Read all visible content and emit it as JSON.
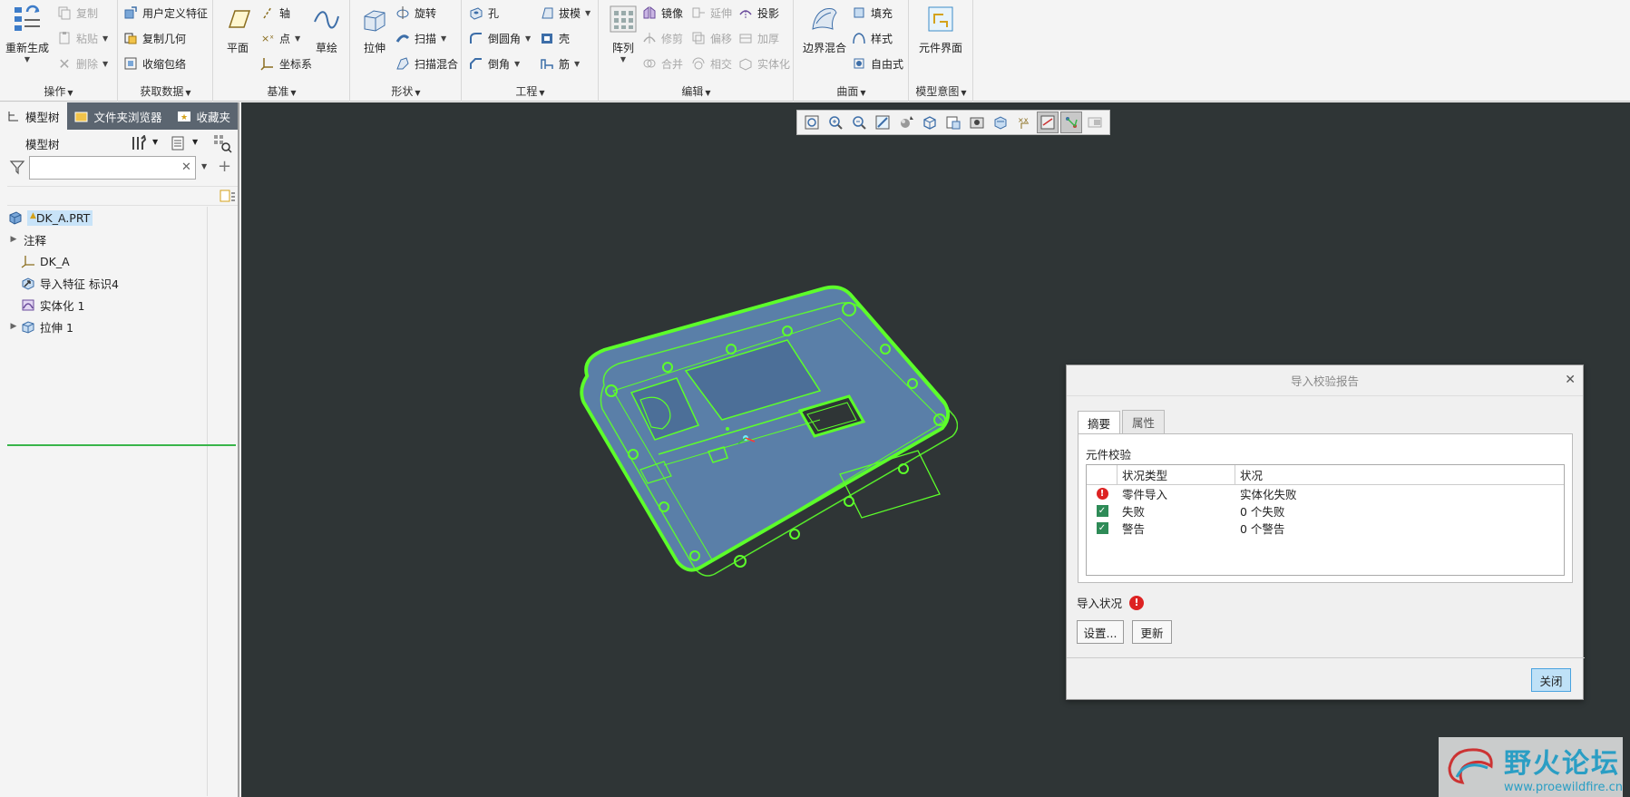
{
  "ribbon": {
    "operations": {
      "label": "操作",
      "regenerate": "重新生成",
      "copy": "复制",
      "paste": "粘贴",
      "delete": "删除"
    },
    "get_data": {
      "label": "获取数据",
      "udf": "用户定义特征",
      "copy_geometry": "复制几何",
      "shrinkwrap": "收缩包络"
    },
    "datum": {
      "label": "基准",
      "plane": "平面",
      "axis": "轴",
      "point": "点",
      "csys": "坐标系",
      "sketch": "草绘"
    },
    "shapes": {
      "label": "形状",
      "extrude": "拉伸",
      "revolve": "旋转",
      "sweep": "扫描",
      "swept_blend": "扫描混合"
    },
    "engineering": {
      "label": "工程",
      "hole": "孔",
      "round": "倒圆角",
      "chamfer": "倒角",
      "draft": "拔模",
      "shell": "壳",
      "rib": "筋"
    },
    "editing": {
      "label": "编辑",
      "pattern": "阵列",
      "mirror": "镜像",
      "trim": "修剪",
      "merge": "合并",
      "extend": "延伸",
      "offset": "偏移",
      "intersect": "相交",
      "project": "投影",
      "thicken": "加厚",
      "solidify": "实体化"
    },
    "surfaces": {
      "label": "曲面",
      "boundary_blend": "边界混合",
      "fill": "填充",
      "style": "样式",
      "freestyle": "自由式"
    },
    "model_intent": {
      "label": "模型意图",
      "component_interface": "元件界面"
    }
  },
  "left_panel": {
    "tabs": [
      "模型树",
      "文件夹浏览器",
      "收藏夹"
    ],
    "tree_title": "模型树",
    "filter_placeholder": "",
    "items": [
      {
        "label": "DK_A.PRT",
        "icon": "part-icon",
        "expandable": false
      },
      {
        "label": "注释",
        "icon": "",
        "expandable": true
      },
      {
        "label": "DK_A",
        "icon": "csys-icon",
        "expandable": false
      },
      {
        "label": "导入特征 标识4",
        "icon": "import-feature-icon",
        "expandable": false
      },
      {
        "label": "实体化 1",
        "icon": "solidify-icon",
        "expandable": false
      },
      {
        "label": "拉伸 1",
        "icon": "extrude-icon",
        "expandable": true
      }
    ]
  },
  "dialog": {
    "title": "导入校验报告",
    "tabs": [
      "摘要",
      "属性"
    ],
    "section_label": "元件校验",
    "columns": [
      "状况类型",
      "状况"
    ],
    "rows": [
      {
        "status_icon": "error-icon",
        "type": "零件导入",
        "status": "实体化失败"
      },
      {
        "status_icon": "check-icon",
        "type": "失败",
        "status": "0 个失败"
      },
      {
        "status_icon": "check-icon",
        "type": "警告",
        "status": "0 个警告"
      }
    ],
    "import_status_label": "导入状况",
    "settings_button": "设置...",
    "update_button": "更新",
    "close_button": "关闭"
  },
  "watermark": {
    "title": "野火论坛",
    "url": "www.proewildfire.cn"
  },
  "colors": {
    "graphics_bg": "#2f3536",
    "model_edges": "#5cff2a",
    "model_fill": "#5a7fa8",
    "nav_tab_bg": "#5b6570"
  }
}
